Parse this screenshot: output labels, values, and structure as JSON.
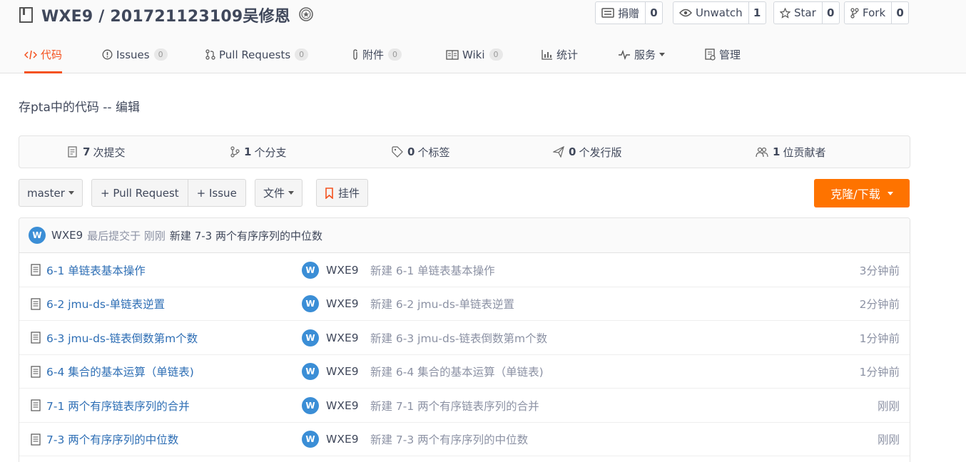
{
  "repo": {
    "title": "WXE9 / 201721123109吴修恩",
    "description": "存pta中的代码",
    "description_sep": " -- ",
    "edit_label": "编辑"
  },
  "actions": {
    "donate": {
      "label": "捐赠",
      "count": "0"
    },
    "watch": {
      "label": "Unwatch",
      "count": "1"
    },
    "star": {
      "label": "Star",
      "count": "0"
    },
    "fork": {
      "label": "Fork",
      "count": "0"
    }
  },
  "tabs": [
    {
      "label": "代码",
      "icon": "code-icon",
      "active": true
    },
    {
      "label": "Issues",
      "count": "0",
      "icon": "issue-icon"
    },
    {
      "label": "Pull Requests",
      "count": "0",
      "icon": "pull-request-icon"
    },
    {
      "label": "附件",
      "count": "0",
      "icon": "paperclip-icon"
    },
    {
      "label": "Wiki",
      "count": "0",
      "icon": "wiki-icon"
    },
    {
      "label": "统计",
      "icon": "bar-chart-icon"
    },
    {
      "label": "服务",
      "icon": "pulse-icon",
      "dropdown": true
    },
    {
      "label": "管理",
      "icon": "settings-doc-icon"
    }
  ],
  "stats": [
    {
      "count": "7",
      "label": "次提交",
      "icon": "commit-doc-icon"
    },
    {
      "count": "1",
      "label": "个分支",
      "icon": "branch-icon"
    },
    {
      "count": "0",
      "label": "个标签",
      "icon": "tag-icon"
    },
    {
      "count": "0",
      "label": "个发行版",
      "icon": "release-icon"
    },
    {
      "count": "1",
      "label": "位贡献者",
      "icon": "contributors-icon"
    }
  ],
  "toolbar": {
    "branch": "master",
    "pull_request": "+ Pull Request",
    "issue": "+ Issue",
    "files": "文件",
    "widget": "挂件",
    "clone": "克隆/下载"
  },
  "last_commit": {
    "avatar_letter": "W",
    "author": "WXE9",
    "meta": "最后提交于 刚刚",
    "message": "新建 7-3 两个有序序列的中位数"
  },
  "files": [
    {
      "name": "6-1 单链表基本操作",
      "avatar": "W",
      "author": "WXE9",
      "message": "新建 6-1 单链表基本操作",
      "time": "3分钟前"
    },
    {
      "name": "6-2 jmu-ds-单链表逆置",
      "avatar": "W",
      "author": "WXE9",
      "message": "新建 6-2 jmu-ds-单链表逆置",
      "time": "2分钟前"
    },
    {
      "name": "6-3 jmu-ds-链表倒数第m个数",
      "avatar": "W",
      "author": "WXE9",
      "message": "新建 6-3 jmu-ds-链表倒数第m个数",
      "time": "1分钟前"
    },
    {
      "name": "6-4 集合的基本运算（单链表)",
      "avatar": "W",
      "author": "WXE9",
      "message": "新建 6-4 集合的基本运算（单链表)",
      "time": "1分钟前"
    },
    {
      "name": "7-1 两个有序链表序列的合并",
      "avatar": "W",
      "author": "WXE9",
      "message": "新建 7-1 两个有序链表序列的合并",
      "time": "刚刚"
    },
    {
      "name": "7-3 两个有序序列的中位数",
      "avatar": "W",
      "author": "WXE9",
      "message": "新建 7-3 两个有序序列的中位数",
      "time": "刚刚"
    }
  ],
  "colors": {
    "accent": "#f4511e",
    "clone_button": "#fe7300",
    "link": "#2f6fb5",
    "avatar": "#3b8ed6"
  }
}
